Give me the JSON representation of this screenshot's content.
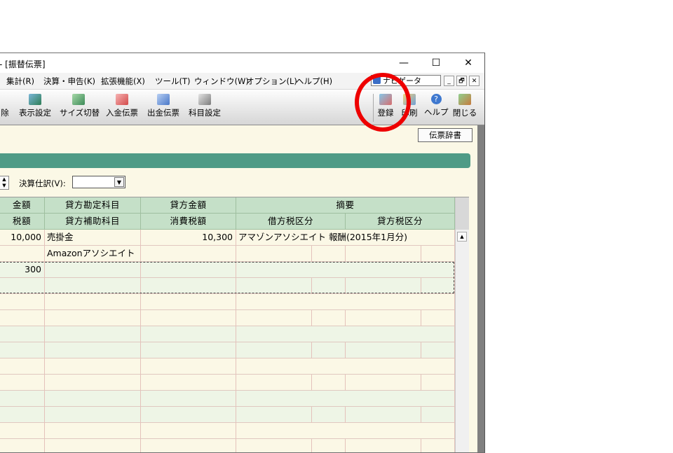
{
  "window": {
    "title": "- [振替伝票]"
  },
  "window_controls": {
    "minimize": "—",
    "maximize": "☐",
    "close": "✕"
  },
  "menu": [
    {
      "label": "集計(R)"
    },
    {
      "label": "決算・申告(K)"
    },
    {
      "label": "拡張機能(X)"
    },
    {
      "label": "ツール(T)"
    },
    {
      "label": "ウィンドウ(W)"
    },
    {
      "label": "オプション(L)"
    },
    {
      "label": "ヘルプ(H)"
    }
  ],
  "navigator": {
    "label": "ナビゲータ"
  },
  "mdi_controls": {
    "minimize": "_",
    "restore": "🗗",
    "close": "✕"
  },
  "toolbar": {
    "left": [
      {
        "label": "除",
        "icon": "delete-icon"
      },
      {
        "label": "表示設定",
        "icon": "display-settings-icon"
      },
      {
        "label": "サイズ切替",
        "icon": "size-switch-icon"
      },
      {
        "label": "入金伝票",
        "icon": "deposit-slip-icon"
      },
      {
        "label": "出金伝票",
        "icon": "withdrawal-slip-icon"
      },
      {
        "label": "科目設定",
        "icon": "account-settings-icon"
      }
    ],
    "right": [
      {
        "label": "登録",
        "icon": "register-icon"
      },
      {
        "label": "印刷",
        "icon": "print-icon"
      },
      {
        "label": "ヘルプ",
        "icon": "help-icon"
      },
      {
        "label": "閉じる",
        "icon": "close-door-icon"
      }
    ]
  },
  "dict_button": "伝票辞書",
  "kessan": {
    "label": "決算仕訳(V):",
    "value": ""
  },
  "grid": {
    "header_top": [
      "金額",
      "貸方勘定科目",
      "貸方金額",
      "摘要"
    ],
    "header_bottom": [
      "税額",
      "貸方補助科目",
      "消費税額",
      "借方税区分",
      "貸方税区分"
    ],
    "rows": [
      {
        "amount": "10,000",
        "account": "売掛金",
        "credit_amount": "10,300",
        "memo": "アマゾンアソシエイト 報酬(2015年1月分)"
      },
      {
        "amount": "",
        "account": "Amazonアソシエイト",
        "credit_amount": "",
        "memo": ""
      },
      {
        "amount": "300",
        "account": "",
        "credit_amount": "",
        "memo": ""
      }
    ]
  },
  "colors": {
    "header_green": "#c5e0c8",
    "bar_green": "#4f9b86",
    "row_cream": "#fbf8e6",
    "row_green": "#eef5e6",
    "highlight": "#ee0000"
  }
}
